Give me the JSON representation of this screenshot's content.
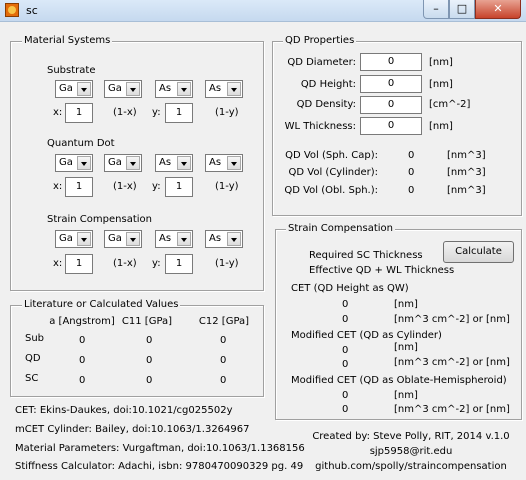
{
  "window": {
    "title": "sc"
  },
  "material_systems": {
    "title": "Material Systems",
    "substrate": {
      "label": "Substrate",
      "selects": [
        "Ga",
        "Ga",
        "As",
        "As"
      ],
      "x_label": "x:",
      "x_value": "1",
      "one_minus_x": "(1-x)",
      "y_label": "y:",
      "y_value": "1",
      "one_minus_y": "(1-y)"
    },
    "quantum_dot": {
      "label": "Quantum Dot",
      "selects": [
        "Ga",
        "Ga",
        "As",
        "As"
      ],
      "x_label": "x:",
      "x_value": "1",
      "one_minus_x": "(1-x)",
      "y_label": "y:",
      "y_value": "1",
      "one_minus_y": "(1-y)"
    },
    "strain_comp": {
      "label": "Strain Compensation",
      "selects": [
        "Ga",
        "Ga",
        "As",
        "As"
      ],
      "x_label": "x:",
      "x_value": "1",
      "one_minus_x": "(1-x)",
      "y_label": "y:",
      "y_value": "1",
      "one_minus_y": "(1-y)"
    }
  },
  "qd_properties": {
    "title": "QD Properties",
    "fields": [
      {
        "label": "QD Diameter:",
        "value": "0",
        "unit": "[nm]"
      },
      {
        "label": "QD Height:",
        "value": "0",
        "unit": "[nm]"
      },
      {
        "label": "QD Density:",
        "value": "0",
        "unit": "[cm^-2]"
      },
      {
        "label": "WL Thickness:",
        "value": "0",
        "unit": "[nm]"
      }
    ],
    "volumes": [
      {
        "label": "QD Vol (Sph. Cap):",
        "value": "0",
        "unit": "[nm^3]"
      },
      {
        "label": "QD Vol (Cylinder):",
        "value": "0",
        "unit": "[nm^3]"
      },
      {
        "label": "QD Vol (Obl. Sph.):",
        "value": "0",
        "unit": "[nm^3]"
      }
    ]
  },
  "literature": {
    "title": "Literature or Calculated Values",
    "headers": [
      "a [Angstrom]",
      "C11 [GPa]",
      "C12 [GPa]"
    ],
    "rows": [
      {
        "name": "Sub",
        "values": [
          "0",
          "0",
          "0"
        ]
      },
      {
        "name": "QD",
        "values": [
          "0",
          "0",
          "0"
        ]
      },
      {
        "name": "SC",
        "values": [
          "0",
          "0",
          "0"
        ]
      }
    ]
  },
  "strain_compensation": {
    "title": "Strain Compensation",
    "required": "Required SC Thickness",
    "effective": "Effective QD + WL Thickness",
    "calculate": "Calculate",
    "cet_title": "CET (QD Height as QW)",
    "cet_v1": "0",
    "cet_u1": "[nm]",
    "cet_v2": "0",
    "cet_u2": "[nm^3 cm^-2] or [nm]",
    "mcet_cyl_title": "Modified CET (QD as Cylinder)",
    "mcet_cyl_v1": "0",
    "mcet_cyl_u1": "[nm]",
    "mcet_cyl_v2": "0",
    "mcet_cyl_u2": "[nm^3 cm^-2] or [nm]",
    "mcet_obl_title": "Modified CET (QD as Oblate-Hemispheroid)",
    "mcet_obl_v1": "0",
    "mcet_obl_u1": "[nm]",
    "mcet_obl_v2": "0",
    "mcet_obl_u2": "[nm^3 cm^-2] or [nm]"
  },
  "references": [
    "CET: Ekins-Daukes, doi:10.1021/cg025502y",
    "mCET Cylinder: Bailey, doi:10.1063/1.3264967",
    "Material Parameters: Vurgaftman, doi:10.1063/1.1368156",
    "Stiffness Calculator: Adachi, isbn: 9780470090329 pg. 49"
  ],
  "credits": {
    "created_by": "Created by: Steve Polly, RIT, 2014 v.1.0",
    "email": "sjp5958@rit.edu",
    "github": "github.com/spolly/straincompensation"
  }
}
